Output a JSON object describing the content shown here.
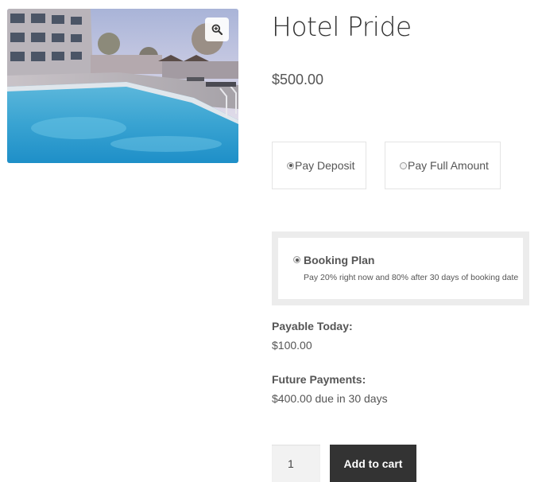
{
  "product": {
    "title": "Hotel Pride",
    "price": "$500.00",
    "image_alt": "Hotel pool"
  },
  "payment_options": {
    "deposit_label": "Pay Deposit",
    "full_label": "Pay Full Amount",
    "selected": "deposit"
  },
  "booking_plan": {
    "title": "Booking Plan",
    "description": "Pay 20% right now and 80% after 30 days of booking date",
    "selected": true
  },
  "payable_today": {
    "label": "Payable Today:",
    "value": "$100.00"
  },
  "future_payments": {
    "label": "Future Payments:",
    "value": "$400.00 due in 30 days"
  },
  "cart": {
    "quantity": "1",
    "button_label": "Add to cart"
  },
  "icons": {
    "zoom": "zoom-in-icon",
    "radio_checked": "radio-checked-icon",
    "radio_unchecked": "radio-unchecked-icon"
  },
  "colors": {
    "button_bg": "#333333",
    "button_text": "#ffffff",
    "plan_frame": "#ececec",
    "text": "#555555",
    "title": "#333333"
  }
}
